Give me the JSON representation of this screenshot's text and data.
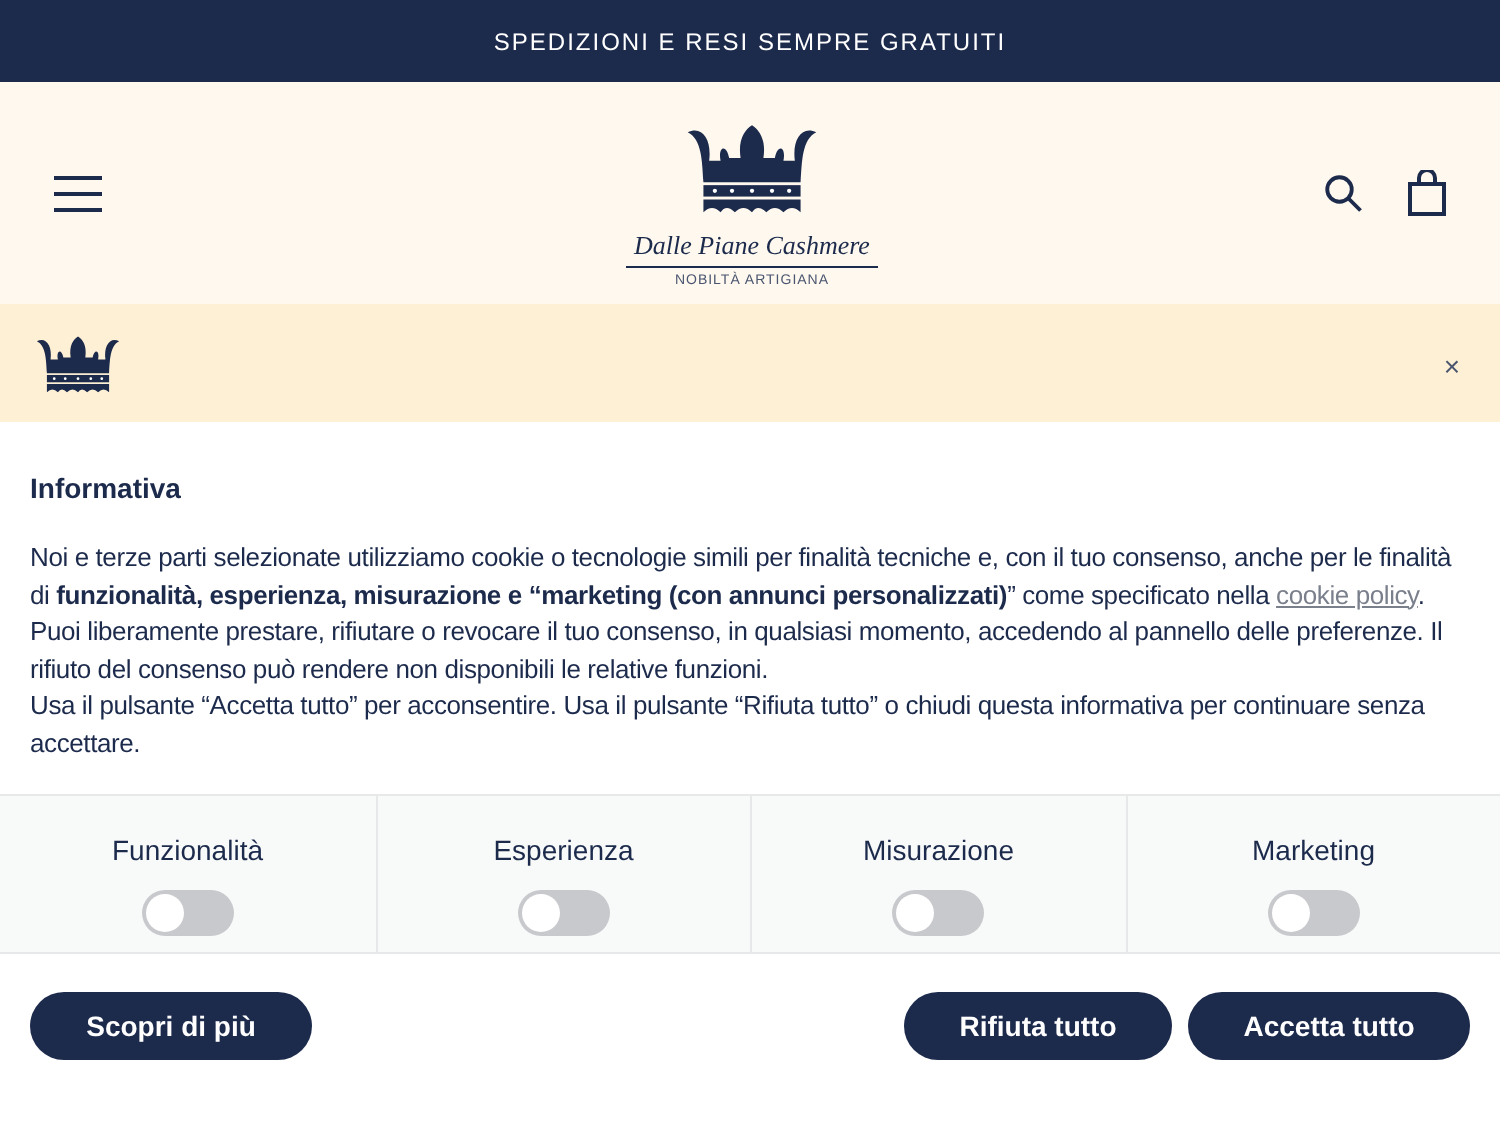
{
  "announcement": "SPEDIZIONI E RESI SEMPRE GRATUITI",
  "logo": {
    "name": "Dalle Piane Cashmere",
    "tagline": "NOBILTÀ ARTIGIANA"
  },
  "consent": {
    "close": "×",
    "title": "Informativa",
    "paragraphs": [
      {
        "text": "Noi e terze parti selezionate utilizziamo cookie o tecnologie simili per finalità tecniche e, con il tuo consenso, anche per le finalità di **funzionalità, esperienza, misurazione e “marketing (con annunci personalizzati)**” come specificato nella",
        "link": "cookie policy",
        "after": "."
      },
      {
        "text": "Puoi liberamente prestare, rifiutare o revocare il tuo consenso, in qualsiasi momento, accedendo al pannello delle preferenze. Il rifiuto del consenso può rendere non disponibili le relative funzioni."
      },
      {
        "text": "Usa il pulsante “Accetta tutto” per acconsentire. Usa il pulsante “Rifiuta tutto” o chiudi questa informativa per continuare senza accettare."
      }
    ],
    "toggles": [
      {
        "label": "Funzionalità",
        "on": false
      },
      {
        "label": "Esperienza",
        "on": false
      },
      {
        "label": "Misurazione",
        "on": false
      },
      {
        "label": "Marketing",
        "on": false
      }
    ],
    "buttons": {
      "left": "Scopri di più",
      "right": [
        "Rifiuta tutto",
        "Accetta tutto"
      ]
    }
  }
}
